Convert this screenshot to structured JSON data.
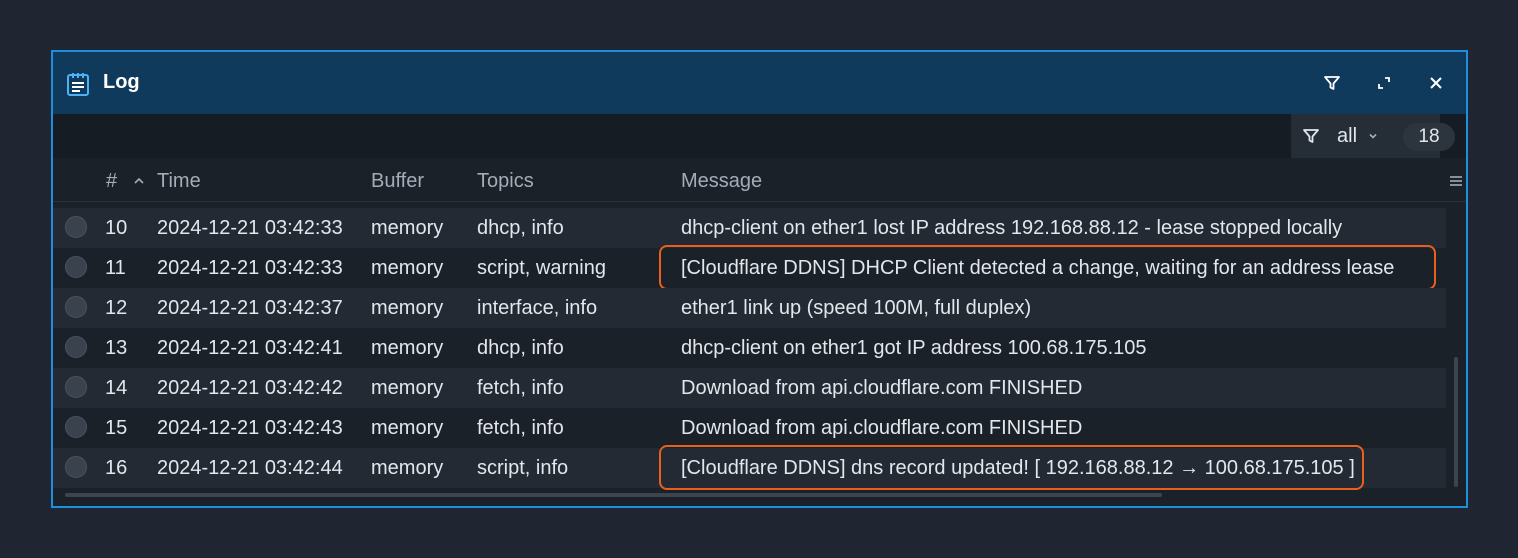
{
  "window": {
    "title": "Log",
    "title_icon": "log-notepad-icon",
    "buttons": [
      "filter-icon",
      "maximize-icon",
      "close-icon"
    ]
  },
  "toolbar": {
    "filter_icon": "filter-icon",
    "filter_value": "all",
    "count": "18"
  },
  "columns": {
    "id": "#",
    "time": "Time",
    "buffer": "Buffer",
    "topics": "Topics",
    "message": "Message"
  },
  "rows": [
    {
      "id": "10",
      "time": "2024-12-21 03:42:33",
      "buffer": "memory",
      "topics": "dhcp, info",
      "message": "dhcp-client on ether1 lost IP address 192.168.88.12 - lease stopped locally"
    },
    {
      "id": "11",
      "time": "2024-12-21 03:42:33",
      "buffer": "memory",
      "topics": "script, warning",
      "message": "[Cloudflare DDNS] DHCP Client detected a change, waiting for an address lease"
    },
    {
      "id": "12",
      "time": "2024-12-21 03:42:37",
      "buffer": "memory",
      "topics": "interface, info",
      "message": "ether1 link up (speed 100M, full duplex)"
    },
    {
      "id": "13",
      "time": "2024-12-21 03:42:41",
      "buffer": "memory",
      "topics": "dhcp, info",
      "message": "dhcp-client on ether1 got IP address 100.68.175.105"
    },
    {
      "id": "14",
      "time": "2024-12-21 03:42:42",
      "buffer": "memory",
      "topics": "fetch, info",
      "message": "Download from api.cloudflare.com FINISHED"
    },
    {
      "id": "15",
      "time": "2024-12-21 03:42:43",
      "buffer": "memory",
      "topics": "fetch, info",
      "message": "Download from api.cloudflare.com FINISHED"
    },
    {
      "id": "16",
      "time": "2024-12-21 03:42:44",
      "buffer": "memory",
      "topics": "script, info",
      "message": "[Cloudflare DDNS] dns record updated! [ 192.168.88.12 → 100.68.175.105 ]"
    }
  ],
  "colors": {
    "accent": "#1e8fe0",
    "titlebar": "#103a5c",
    "highlight": "#e8601c"
  }
}
